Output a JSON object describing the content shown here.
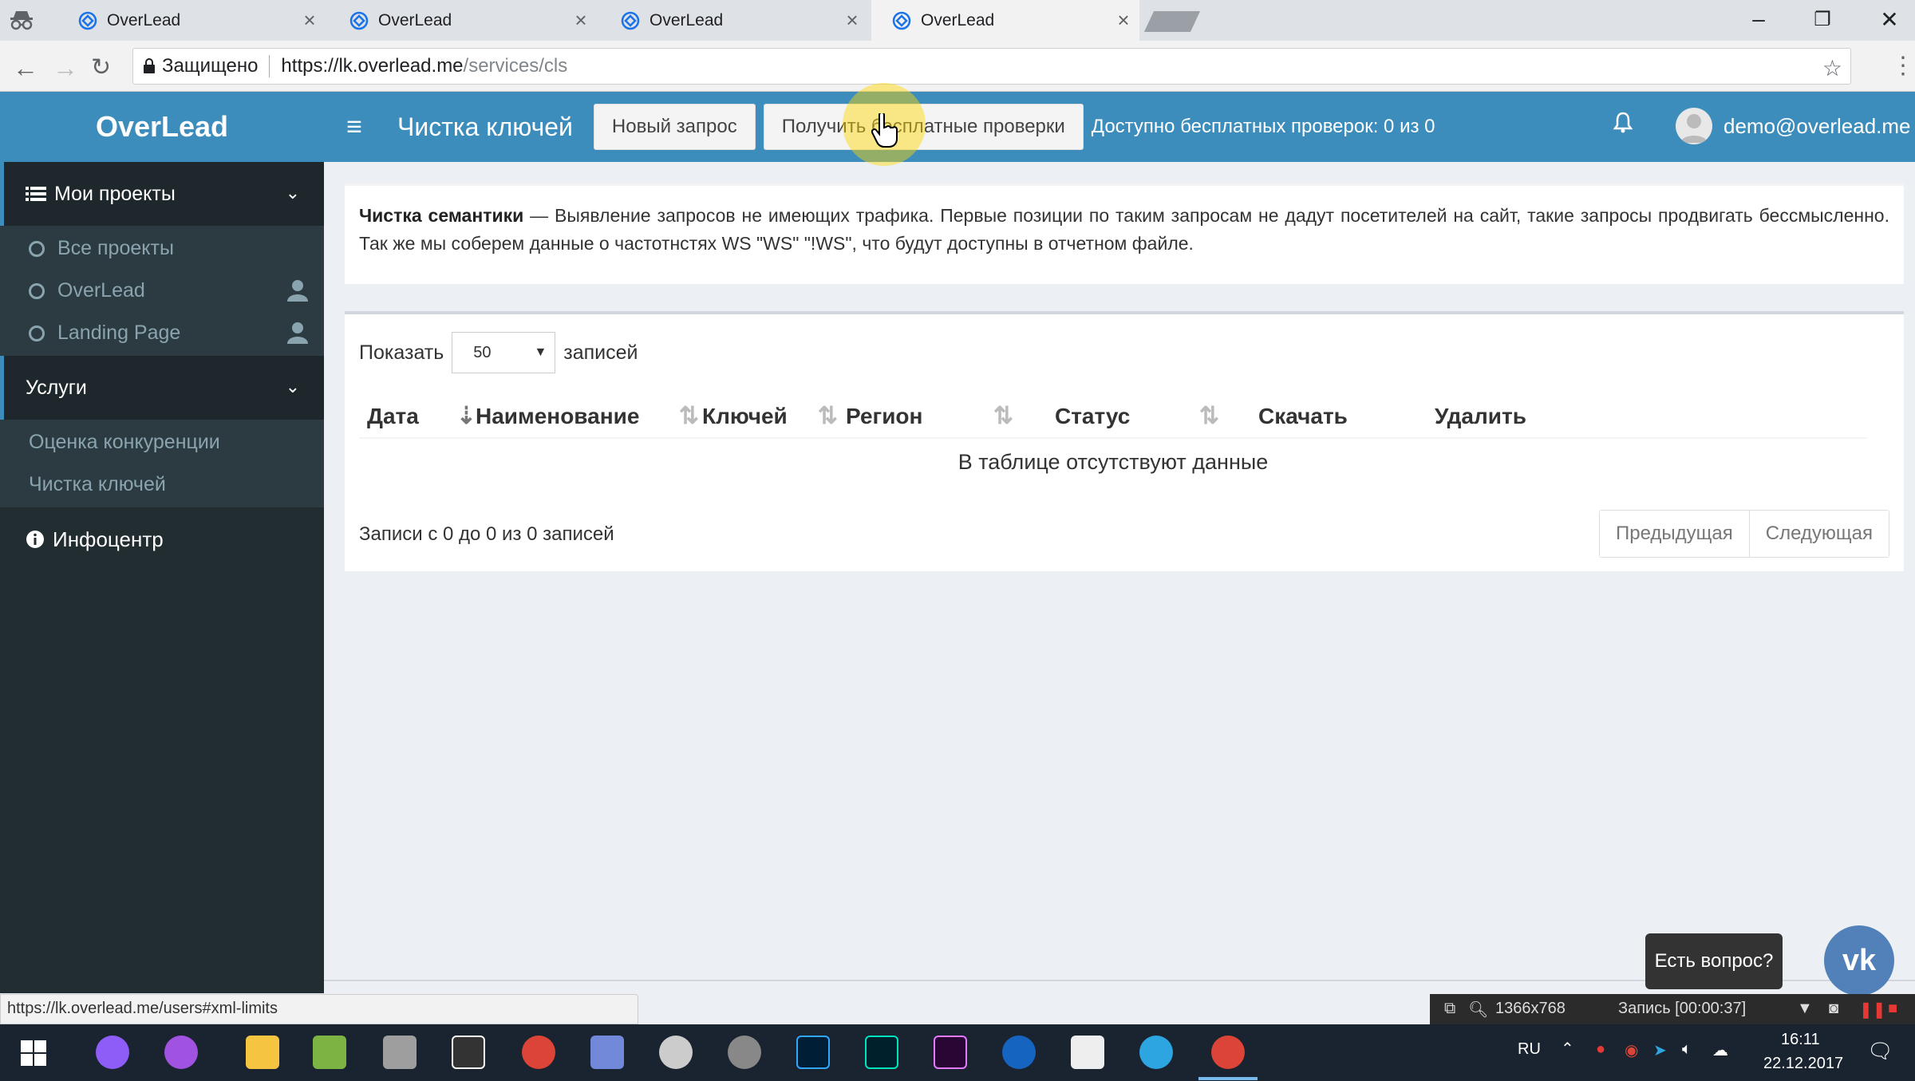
{
  "browser": {
    "tabs": [
      {
        "title": "OverLead"
      },
      {
        "title": "OverLead"
      },
      {
        "title": "OverLead"
      },
      {
        "title": "OverLead"
      }
    ],
    "secure_label": "Защищено",
    "url_host": "https://lk.overlead.me",
    "url_path": "/services/cls"
  },
  "header": {
    "brand": "OverLead",
    "page_title": "Чистка ключей",
    "new_request_label": "Новый запрос",
    "free_checks_label": "Получить бесплатные проверки",
    "free_checks_info": "Доступно бесплатных проверок: 0 из 0",
    "user_email": "demo@overlead.me"
  },
  "sidebar": {
    "projects_header": "Мои проекты",
    "projects": [
      {
        "label": "Все проекты"
      },
      {
        "label": "OverLead"
      },
      {
        "label": "Landing Page"
      }
    ],
    "services_header": "Услуги",
    "services": [
      {
        "label": "Оценка конкуренции"
      },
      {
        "label": "Чистка ключей"
      }
    ],
    "infocenter": "Инфоцентр"
  },
  "description": {
    "title": "Чистка семантики",
    "text": " — Выявление запросов не имеющих трафика. Первые позиции по таким запросам не дадут посетителей на сайт, такие запросы продвигать бессмысленно. Так же мы соберем данные о частотнстях WS \"WS\" \"!WS\", что будут доступны в отчетном файле."
  },
  "table": {
    "show_label": "Показать",
    "page_length": "50",
    "entries_label": "записей",
    "columns": [
      "Дата",
      "Наименование",
      "Ключей",
      "Регион",
      "Статус",
      "Скачать",
      "Удалить"
    ],
    "empty_text": "В таблице отсутствуют данные",
    "info": "Записи с 0 до 0 из 0 записей",
    "prev_label": "Предыдущая",
    "next_label": "Следующая"
  },
  "status_bar_url": "https://lk.overlead.me/users#xml-limits",
  "chat": {
    "bubble_text": "Есть вопрос?"
  },
  "recorder": {
    "resolution": "1366x768",
    "record_label": "Запись [00:00:37]"
  },
  "taskbar": {
    "language": "RU",
    "time": "16:11",
    "date": "22.12.2017"
  },
  "colors": {
    "header": "#3c8dbc",
    "sidebar": "#222d32",
    "content_bg": "#ecf0f5"
  }
}
